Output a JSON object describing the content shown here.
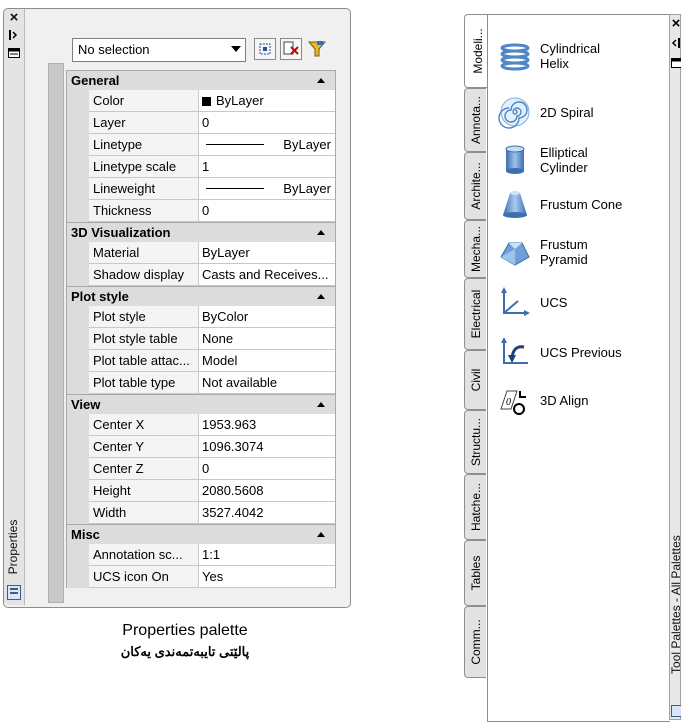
{
  "properties": {
    "title": "Properties",
    "close_glyph": "×",
    "selection": "No selection",
    "categories": [
      {
        "name": "General",
        "rows": [
          {
            "name": "Color",
            "value": "ByLayer",
            "kind": "swatch"
          },
          {
            "name": "Layer",
            "value": "0"
          },
          {
            "name": "Linetype",
            "value": "ByLayer",
            "kind": "line"
          },
          {
            "name": "Linetype scale",
            "value": "1"
          },
          {
            "name": "Lineweight",
            "value": "ByLayer",
            "kind": "line"
          },
          {
            "name": "Thickness",
            "value": "0"
          }
        ]
      },
      {
        "name": "3D Visualization",
        "rows": [
          {
            "name": "Material",
            "value": "ByLayer"
          },
          {
            "name": "Shadow display",
            "value": "Casts and Receives..."
          }
        ]
      },
      {
        "name": "Plot style",
        "rows": [
          {
            "name": "Plot style",
            "value": "ByColor"
          },
          {
            "name": "Plot style table",
            "value": "None"
          },
          {
            "name": "Plot table attac...",
            "value": "Model"
          },
          {
            "name": "Plot table type",
            "value": "Not available"
          }
        ]
      },
      {
        "name": "View",
        "rows": [
          {
            "name": "Center X",
            "value": "1953.963"
          },
          {
            "name": "Center Y",
            "value": "1096.3074"
          },
          {
            "name": "Center Z",
            "value": "0"
          },
          {
            "name": "Height",
            "value": "2080.5608"
          },
          {
            "name": "Width",
            "value": "3527.4042"
          }
        ]
      },
      {
        "name": "Misc",
        "rows": [
          {
            "name": "Annotation sc...",
            "value": "1:1"
          },
          {
            "name": "UCS icon On",
            "value": "Yes"
          }
        ]
      }
    ],
    "caption": "Properties palette",
    "caption_kurdish": "پالێتی تایبەتمەندی یەکان"
  },
  "tool_palettes": {
    "title": "Tool Palettes - All Palettes",
    "close_glyph": "×",
    "tabs": [
      "Modeli...",
      "Annota...",
      "Archite...",
      "Mecha...",
      "Electrical",
      "Civil",
      "Structu...",
      "Hatche...",
      "Tables",
      "Comm..."
    ],
    "active_tab": "Modeli...",
    "tools": [
      {
        "label_line1": "Cylindrical",
        "label_line2": "Helix",
        "icon": "helix-icon"
      },
      {
        "label_line1": "2D Spiral",
        "label_line2": "",
        "icon": "spiral-icon"
      },
      {
        "label_line1": "Elliptical",
        "label_line2": "Cylinder",
        "icon": "cylinder-icon"
      },
      {
        "label_line1": "Frustum Cone",
        "label_line2": "",
        "icon": "frustum-cone-icon"
      },
      {
        "label_line1": "Frustum",
        "label_line2": "Pyramid",
        "icon": "frustum-pyramid-icon"
      },
      {
        "label_line1": "UCS",
        "label_line2": "",
        "icon": "ucs-icon"
      },
      {
        "label_line1": "UCS Previous",
        "label_line2": "",
        "icon": "ucs-previous-icon"
      },
      {
        "label_line1": "3D Align",
        "label_line2": "",
        "icon": "3d-align-icon"
      }
    ]
  },
  "colors": {
    "header_gray": "#dcdcdc",
    "border": "#8c8c8c",
    "tool_blue": "#6a9bd1"
  }
}
